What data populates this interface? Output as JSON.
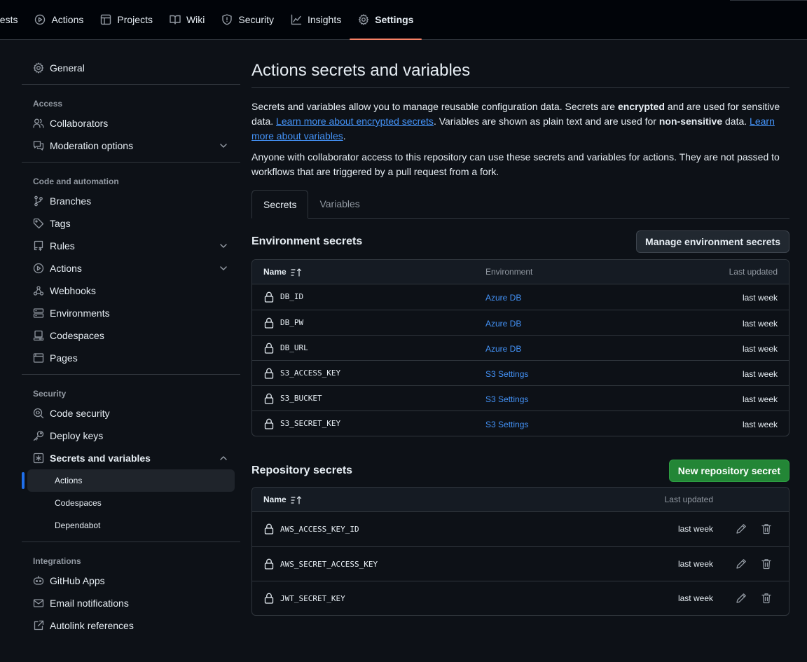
{
  "topnav": {
    "tabs": [
      {
        "label": "uests",
        "icon": "pull-request-icon"
      },
      {
        "label": "Actions",
        "icon": "play-icon"
      },
      {
        "label": "Projects",
        "icon": "table-icon"
      },
      {
        "label": "Wiki",
        "icon": "book-icon"
      },
      {
        "label": "Security",
        "icon": "shield-icon"
      },
      {
        "label": "Insights",
        "icon": "graph-icon"
      },
      {
        "label": "Settings",
        "icon": "gear-icon",
        "active": true
      }
    ]
  },
  "sidebar": {
    "general": "General",
    "groups": {
      "access": "Access",
      "code_automation": "Code and automation",
      "security": "Security",
      "integrations": "Integrations"
    },
    "items": {
      "collaborators": "Collaborators",
      "moderation": "Moderation options",
      "branches": "Branches",
      "tags": "Tags",
      "rules": "Rules",
      "actions": "Actions",
      "webhooks": "Webhooks",
      "environments": "Environments",
      "codespaces": "Codespaces",
      "pages": "Pages",
      "code_security": "Code security",
      "deploy_keys": "Deploy keys",
      "secrets_variables": "Secrets and variables",
      "sub_actions": "Actions",
      "sub_codespaces": "Codespaces",
      "sub_dependabot": "Dependabot",
      "github_apps": "GitHub Apps",
      "email_notifications": "Email notifications",
      "autolink": "Autolink references"
    }
  },
  "main": {
    "title": "Actions secrets and variables",
    "intro": {
      "p1": "Secrets and variables allow you to manage reusable configuration data. Secrets are ",
      "p1_bold": "encrypted",
      "p2": " and are used for sensitive data. ",
      "link1": "Learn more about encrypted secrets",
      "p3": ". Variables are shown as plain text and are used for ",
      "p3_bold": "non-sensitive",
      "p4": " data. ",
      "link2": "Learn more about variables",
      "p5": "."
    },
    "intro2": "Anyone with collaborator access to this repository can use these secrets and variables for actions. They are not passed to workflows that are triggered by a pull request from a fork.",
    "tabs": {
      "secrets": "Secrets",
      "variables": "Variables"
    },
    "env_secrets": {
      "title": "Environment secrets",
      "button": "Manage environment secrets",
      "headers": {
        "name": "Name",
        "environment": "Environment",
        "updated": "Last updated"
      },
      "rows": [
        {
          "name": "DB_ID",
          "env": "Azure DB",
          "updated": "last week"
        },
        {
          "name": "DB_PW",
          "env": "Azure DB",
          "updated": "last week"
        },
        {
          "name": "DB_URL",
          "env": "Azure DB",
          "updated": "last week"
        },
        {
          "name": "S3_ACCESS_KEY",
          "env": "S3 Settings",
          "updated": "last week"
        },
        {
          "name": "S3_BUCKET",
          "env": "S3 Settings",
          "updated": "last week"
        },
        {
          "name": "S3_SECRET_KEY",
          "env": "S3 Settings",
          "updated": "last week"
        }
      ]
    },
    "repo_secrets": {
      "title": "Repository secrets",
      "button": "New repository secret",
      "headers": {
        "name": "Name",
        "updated": "Last updated"
      },
      "rows": [
        {
          "name": "AWS_ACCESS_KEY_ID",
          "updated": "last week"
        },
        {
          "name": "AWS_SECRET_ACCESS_KEY",
          "updated": "last week"
        },
        {
          "name": "JWT_SECRET_KEY",
          "updated": "last week"
        }
      ]
    }
  },
  "colors": {
    "background": "#0d1117",
    "topbar": "#010409",
    "link": "#4493f8",
    "active_tab_underline": "#f78166",
    "primary_button": "#238636",
    "selection_indicator": "#1f6feb"
  }
}
